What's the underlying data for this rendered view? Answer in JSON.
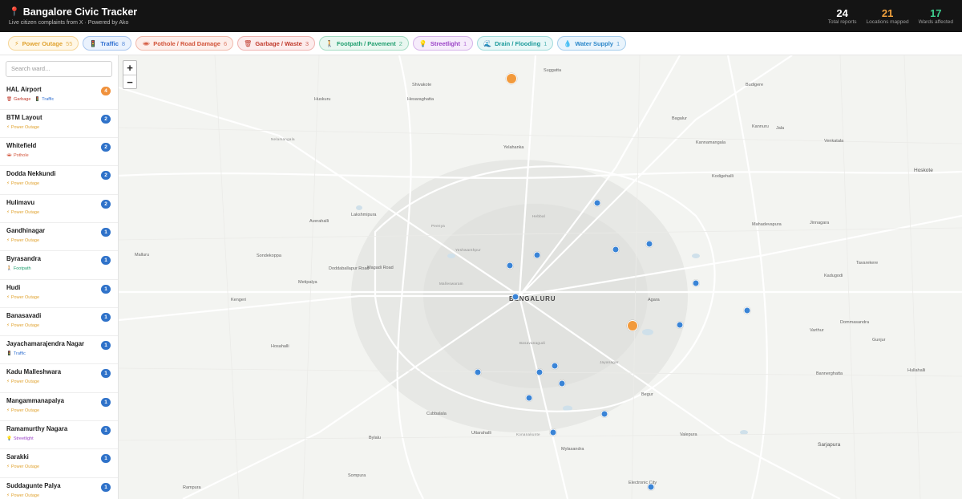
{
  "header": {
    "title": "Bangalore Civic Tracker",
    "subtitle": "Live citizen complaints from X · Powered by Ako",
    "stats": [
      {
        "value": "24",
        "label": "Total reports",
        "color": "#ffffff"
      },
      {
        "value": "21",
        "label": "Locations mapped",
        "color": "#f0a03c"
      },
      {
        "value": "17",
        "label": "Wards affected",
        "color": "#3ecf8e"
      }
    ]
  },
  "filters": [
    {
      "icon": "⚡",
      "label": "Power Outage",
      "count": "55",
      "color": "#e0a22e",
      "bg": "#fff7e6",
      "border": "#f6d596"
    },
    {
      "icon": "🚦",
      "label": "Traffic",
      "count": "8",
      "color": "#2f6fd1",
      "bg": "#eaf2fd",
      "border": "#a9c6ef"
    },
    {
      "icon": "🕳",
      "label": "Pothole / Road Damage",
      "count": "6",
      "color": "#d2543a",
      "bg": "#fdeeea",
      "border": "#f1b9ab"
    },
    {
      "icon": "🗑",
      "label": "Garbage / Waste",
      "count": "3",
      "color": "#c0392b",
      "bg": "#fcecec",
      "border": "#efb3b0"
    },
    {
      "icon": "🚶",
      "label": "Footpath / Pavement",
      "count": "2",
      "color": "#1f9e6e",
      "bg": "#e8f7f0",
      "border": "#a4dcc3"
    },
    {
      "icon": "💡",
      "label": "Streetlight",
      "count": "1",
      "color": "#9b43c7",
      "bg": "#f6ecfb",
      "border": "#d6b4ea"
    },
    {
      "icon": "🌊",
      "label": "Drain / Flooding",
      "count": "1",
      "color": "#1a9a9a",
      "bg": "#e7f7f7",
      "border": "#a2dcdc"
    },
    {
      "icon": "💧",
      "label": "Water Supply",
      "count": "1",
      "color": "#2a86c9",
      "bg": "#e9f4fc",
      "border": "#a6cdec"
    }
  ],
  "sidebar": {
    "search_placeholder": "Search ward...",
    "wards": [
      {
        "name": "HAL Airport",
        "count": "4",
        "count_color": "#f0913c",
        "tags": [
          {
            "icon": "🗑",
            "label": "Garbage",
            "color": "#c0392b"
          },
          {
            "icon": "🚦",
            "label": "Traffic",
            "color": "#2f6fd1"
          }
        ]
      },
      {
        "name": "BTM Layout",
        "count": "2",
        "count_color": "#2f72c9",
        "tags": [
          {
            "icon": "⚡",
            "label": "Power Outage",
            "color": "#e0a22e"
          }
        ]
      },
      {
        "name": "Whitefield",
        "count": "2",
        "count_color": "#2f72c9",
        "tags": [
          {
            "icon": "🕳",
            "label": "Pothole",
            "color": "#d2543a"
          }
        ]
      },
      {
        "name": "Dodda Nekkundi",
        "count": "2",
        "count_color": "#2f72c9",
        "tags": [
          {
            "icon": "⚡",
            "label": "Power Outage",
            "color": "#e0a22e"
          }
        ]
      },
      {
        "name": "Hulimavu",
        "count": "2",
        "count_color": "#2f72c9",
        "tags": [
          {
            "icon": "⚡",
            "label": "Power Outage",
            "color": "#e0a22e"
          }
        ]
      },
      {
        "name": "Gandhinagar",
        "count": "1",
        "count_color": "#2f72c9",
        "tags": [
          {
            "icon": "⚡",
            "label": "Power Outage",
            "color": "#e0a22e"
          }
        ]
      },
      {
        "name": "Byrasandra",
        "count": "1",
        "count_color": "#2f72c9",
        "tags": [
          {
            "icon": "🚶",
            "label": "Footpath",
            "color": "#1f9e6e"
          }
        ]
      },
      {
        "name": "Hudi",
        "count": "1",
        "count_color": "#2f72c9",
        "tags": [
          {
            "icon": "⚡",
            "label": "Power Outage",
            "color": "#e0a22e"
          }
        ]
      },
      {
        "name": "Banasavadi",
        "count": "1",
        "count_color": "#2f72c9",
        "tags": [
          {
            "icon": "⚡",
            "label": "Power Outage",
            "color": "#e0a22e"
          }
        ]
      },
      {
        "name": "Jayachamarajendra Nagar",
        "count": "1",
        "count_color": "#2f72c9",
        "tags": [
          {
            "icon": "🚦",
            "label": "Traffic",
            "color": "#2f6fd1"
          }
        ]
      },
      {
        "name": "Kadu Malleshwara",
        "count": "1",
        "count_color": "#2f72c9",
        "tags": [
          {
            "icon": "⚡",
            "label": "Power Outage",
            "color": "#e0a22e"
          }
        ]
      },
      {
        "name": "Mangammanapalya",
        "count": "1",
        "count_color": "#2f72c9",
        "tags": [
          {
            "icon": "⚡",
            "label": "Power Outage",
            "color": "#e0a22e"
          }
        ]
      },
      {
        "name": "Ramamurthy Nagara",
        "count": "1",
        "count_color": "#2f72c9",
        "tags": [
          {
            "icon": "💡",
            "label": "Streetlight",
            "color": "#9b43c7"
          }
        ]
      },
      {
        "name": "Sarakki",
        "count": "1",
        "count_color": "#2f72c9",
        "tags": [
          {
            "icon": "⚡",
            "label": "Power Outage",
            "color": "#e0a22e"
          }
        ]
      },
      {
        "name": "Suddagunte Palya",
        "count": "1",
        "count_color": "#2f72c9",
        "tags": [
          {
            "icon": "⚡",
            "label": "Power Outage",
            "color": "#e0a22e"
          }
        ]
      }
    ]
  },
  "map": {
    "zoom_in": "+",
    "zoom_out": "−",
    "city_label": "BENGALURU",
    "places": [
      "Suggatta",
      "Shivakote",
      "Huskuru",
      "Hesaraghatta",
      "Budigere",
      "Nelamangala",
      "Yelahanka",
      "Kannamangala",
      "Bagalur",
      "Jala",
      "Kannuru",
      "Venkatala",
      "Hoskote",
      "Kodigehalli",
      "Hebbal",
      "Mahadevapura",
      "Malluru",
      "Lakshmipura",
      "Averahalli",
      "Peenya",
      "Jinnagara",
      "Malleswaram",
      "Yeshwanthpur",
      "Tavarekere",
      "Kadugodi",
      "Magadi Road",
      "Basavanagudi",
      "Varthur",
      "Doddaballapur Road",
      "Kengeri",
      "Jayanagar",
      "Hosahalli",
      "Bannerghatta",
      "Konanakunte",
      "Uttarahalli",
      "Bylalu",
      "Sompura",
      "Cubbalala",
      "Mylasandra",
      "Sarjapura",
      "Electronic City",
      "Rampura",
      "Agara",
      "Begur",
      "Valepura",
      "Sondekoppa",
      "Metipalya",
      "Dommasandra",
      "Gunjur",
      "Hullahalli"
    ]
  }
}
